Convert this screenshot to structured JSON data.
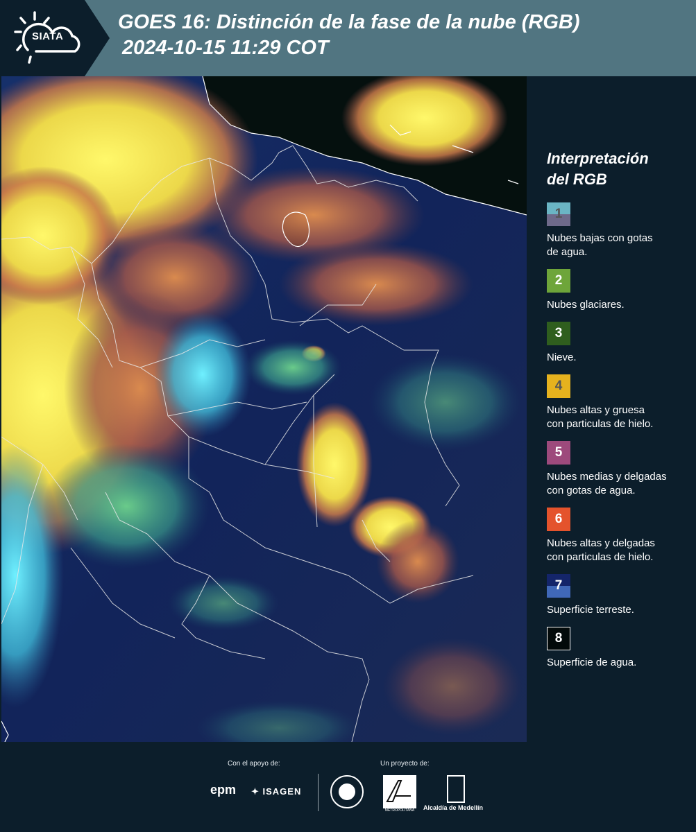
{
  "header": {
    "logo_text": "SIATA",
    "title_line1": "GOES 16: Distinción de la fase de la nube (RGB)",
    "title_line2": "2024-10-15 11:29 COT"
  },
  "legend": {
    "title_line1": "Interpretación",
    "title_line2": "del RGB",
    "items": [
      {
        "num": "1",
        "label_line1": "Nubes bajas con gotas",
        "label_line2": "de agua.",
        "color_top": "#6bb5c4",
        "color_bottom": "#6e6a8a",
        "num_color": "#555555"
      },
      {
        "num": "2",
        "label_line1": "Nubes glaciares.",
        "label_line2": "",
        "color_top": "#6ea53a",
        "color_bottom": "#6ea53a",
        "num_color": "#ffffff"
      },
      {
        "num": "3",
        "label_line1": "Nieve.",
        "label_line2": "",
        "color_top": "#2f5e1e",
        "color_bottom": "#2f5e1e",
        "num_color": "#ffffff"
      },
      {
        "num": "4",
        "label_line1": "Nubes altas y gruesa",
        "label_line2": "con particulas de hielo.",
        "color_top": "#e6b21e",
        "color_bottom": "#e6b21e",
        "num_color": "#555555"
      },
      {
        "num": "5",
        "label_line1": "Nubes medias y delgadas",
        "label_line2": "con gotas de agua.",
        "color_top": "#9d4a7c",
        "color_bottom": "#9d4a7c",
        "num_color": "#ffffff"
      },
      {
        "num": "6",
        "label_line1": "Nubes altas y delgadas",
        "label_line2": "con particulas de hielo.",
        "color_top": "#e4532c",
        "color_bottom": "#e4532c",
        "num_color": "#ffffff"
      },
      {
        "num": "7",
        "label_line1": "Superficie terreste.",
        "label_line2": "",
        "color_top": "#14256a",
        "color_bottom": "#4068b8",
        "num_color": "#ffffff"
      },
      {
        "num": "8",
        "label_line1": "Superficie de agua.",
        "label_line2": "",
        "color_top": "#030a0a",
        "color_bottom": "#030a0a",
        "num_color": "#ffffff"
      }
    ]
  },
  "footer": {
    "support_label": "Con el apoyo de:",
    "project_label": "Un proyecto de:",
    "epm": "epm",
    "isagen": "ISAGEN",
    "amva_text": "METROPOLITANA",
    "medellin": "Alcaldía de Medellín"
  },
  "colors": {
    "header_bg": "#517581",
    "page_bg": "#0c1e2b",
    "logo_plate": "#0c1e2b"
  }
}
